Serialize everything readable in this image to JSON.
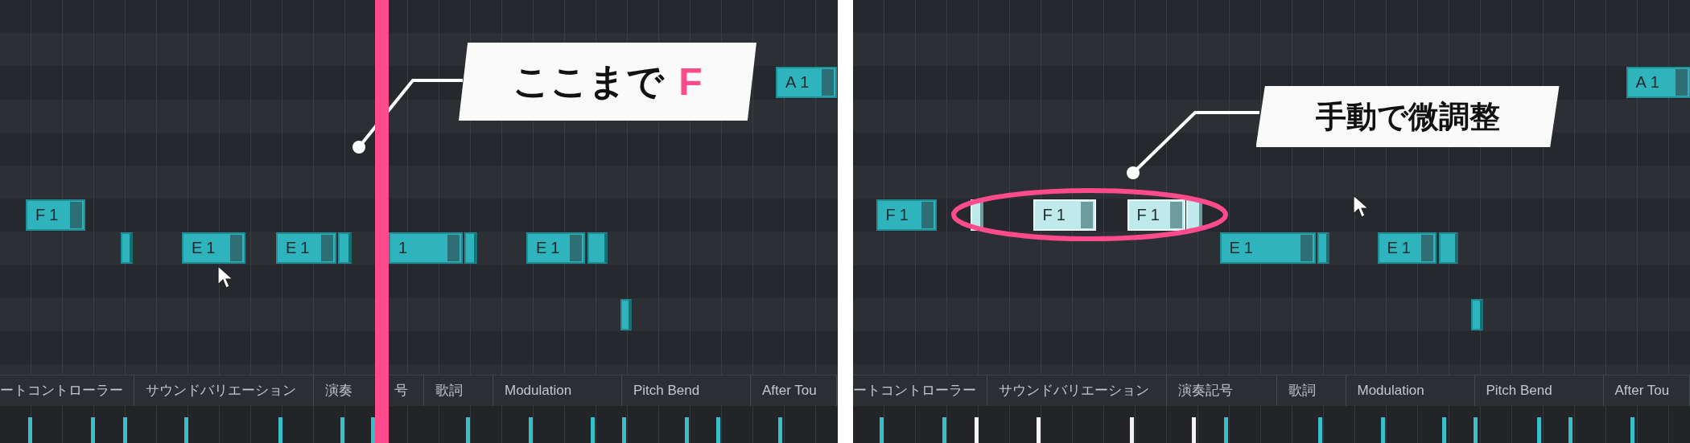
{
  "panels": [
    {
      "callout": {
        "text": "ここまで",
        "accent": "F"
      },
      "notes": [
        {
          "label": "F1",
          "selected": false
        },
        {
          "selected": false
        },
        {
          "label": "E1",
          "selected": false
        },
        {
          "label": "E1",
          "selected": false
        },
        {
          "selected": false
        },
        {
          "label": "1",
          "selected": false
        },
        {
          "selected": false
        },
        {
          "label": "E1",
          "selected": false
        },
        {
          "selected": false
        },
        {
          "selected": false
        },
        {
          "label": "A1",
          "selected": false
        }
      ],
      "tabs": [
        "ートコントローラー",
        "サウンドバリエーション",
        [
          "演奏",
          "号"
        ],
        "歌詞",
        "Modulation",
        "Pitch Bend",
        "After Tou"
      ],
      "velocity": [
        {
          "selected": false
        },
        {
          "selected": false
        },
        {
          "selected": false
        },
        {
          "selected": false
        },
        {
          "selected": false
        },
        {
          "selected": false
        },
        {
          "selected": false
        },
        {
          "selected": false
        },
        {
          "selected": false
        },
        {
          "selected": false
        },
        {
          "selected": false
        },
        {
          "selected": false
        },
        {
          "selected": false
        },
        {
          "selected": false
        }
      ],
      "playhead": true
    },
    {
      "callout": {
        "text": "手動で微調整"
      },
      "notes": [
        {
          "label": "F1",
          "selected": false
        },
        {
          "selected": true
        },
        {
          "label": "F1",
          "selected": true
        },
        {
          "label": "F1",
          "selected": true
        },
        {
          "selected": true
        },
        {
          "label": "E1",
          "selected": false
        },
        {
          "selected": false
        },
        {
          "label": "E1",
          "selected": false
        },
        {
          "selected": false
        },
        {
          "selected": false
        },
        {
          "label": "A1",
          "selected": false
        }
      ],
      "tabs": [
        "ートコントローラー",
        "サウンドバリエーション",
        "演奏記号",
        "歌詞",
        "Modulation",
        "Pitch Bend",
        "After Tou"
      ],
      "velocity": [
        {
          "selected": false
        },
        {
          "selected": false
        },
        {
          "selected": true
        },
        {
          "selected": true
        },
        {
          "selected": true
        },
        {
          "selected": true
        },
        {
          "selected": false
        },
        {
          "selected": false
        },
        {
          "selected": false
        },
        {
          "selected": false
        },
        {
          "selected": false
        },
        {
          "selected": false
        },
        {
          "selected": false
        },
        {
          "selected": false
        }
      ],
      "playhead": false
    }
  ]
}
